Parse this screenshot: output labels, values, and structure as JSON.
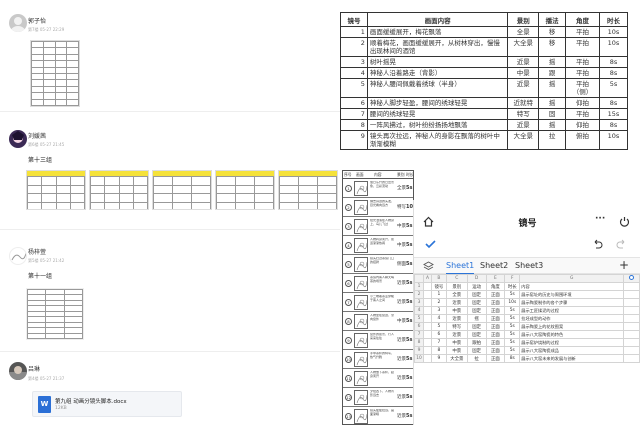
{
  "feed": {
    "posts": [
      {
        "name": "郭子怡",
        "meta": "第7楼  05-27 22:29"
      },
      {
        "name": "刘媛茜",
        "meta": "第6楼  05-27 21:45",
        "text": "第十三组"
      },
      {
        "name": "杨梓萱",
        "meta": "第5楼  05-27 21:42",
        "text": "第十一组"
      },
      {
        "name": "吕琳",
        "meta": "第4楼  05-27 21:37",
        "attachment": {
          "icon": "word-doc-icon",
          "name": "第九组 动画分镜头脚本.docx",
          "size": "12KB",
          "glyph": "W"
        }
      }
    ]
  },
  "shot_table": {
    "headers": [
      "镜号",
      "画面内容",
      "景别",
      "播法",
      "角度",
      "时长"
    ],
    "rows": [
      [
        "1",
        "画面缓缓展开，梅花飘落",
        "全景",
        "移",
        "平拍",
        "10s"
      ],
      [
        "2",
        "顺着梅花，画面缓缓展开，从树林穿出，慢慢出现林间的酒馆",
        "大全景",
        "移",
        "平拍",
        "10s"
      ],
      [
        "3",
        "树叶摇晃",
        "近景",
        "摇",
        "平拍",
        "8s"
      ],
      [
        "4",
        "神秘人沿着路走（背影）",
        "中景",
        "跟",
        "平拍",
        "8s"
      ],
      [
        "5",
        "神秘人腰间佩戴着绣球（半身）",
        "近景",
        "摇",
        "平拍（侧）",
        "5s"
      ],
      [
        "6",
        "神秘人脚步轻盈，腰间的绣球轻晃",
        "近就特",
        "摇",
        "仰拍",
        "8s"
      ],
      [
        "7",
        "腰间的绣球轻晃",
        "特写",
        "固",
        "平拍",
        "15s"
      ],
      [
        "8",
        "一阵风拂过，树叶纷纷扬扬地飘落",
        "近景",
        "摇",
        "仰拍",
        "8s"
      ],
      [
        "9",
        "镜头再次拉远，神秘人的身影在飘落的树叶中渐渐模糊",
        "大全景",
        "拉",
        "俯拍",
        "10s"
      ]
    ]
  },
  "storyboard": {
    "headers": [
      "序号",
      "画面",
      "内容",
      "景别",
      "时长"
    ],
    "rows": [
      {
        "num": "1",
        "desc": "旭日东升的日出景象，云彩流动",
        "kind": "全景",
        "dur": "5s"
      },
      {
        "num": "2",
        "desc": "拂去耳边的头发，目光看向远方",
        "kind": "特写",
        "dur": "10s"
      },
      {
        "num": "3",
        "desc": "阳光洒落在人物身上，鸟儿飞过",
        "kind": "中景",
        "dur": "5s"
      },
      {
        "num": "4",
        "desc": "人物转身离开，街道渐渐热闹",
        "kind": "中景",
        "dur": "5s"
      },
      {
        "num": "5",
        "desc": "镜头扫过茶馆门口的招牌",
        "kind": "侧面",
        "dur": "5s"
      },
      {
        "num": "6",
        "desc": "茶馆内客人聊天喝茶的场景",
        "kind": "近景",
        "dur": "5s"
      },
      {
        "num": "7",
        "desc": "小二端着茶壶穿梭于客人之间",
        "kind": "近景",
        "dur": "5s"
      },
      {
        "num": "8",
        "desc": "人物坐在窗边，望向窗外",
        "kind": "中景",
        "dur": "5s"
      },
      {
        "num": "9",
        "desc": "窗外的街景，行人来来往往",
        "kind": "近景",
        "dur": "5s"
      },
      {
        "num": "10",
        "desc": "手中茶杯的特写，热气升腾",
        "kind": "近景",
        "dur": "5s"
      },
      {
        "num": "11",
        "desc": "人物放下茶杯，起身离开",
        "kind": "近景",
        "dur": "5s"
      },
      {
        "num": "12",
        "desc": "夕阳西下，人物背影远去",
        "kind": "近景",
        "dur": "5s"
      },
      {
        "num": "13",
        "desc": "镜头缓缓拉远，画面渐暗",
        "kind": "近景",
        "dur": "5s"
      }
    ]
  },
  "sheet_app": {
    "title": "镜号",
    "icons": {
      "home": "home-icon",
      "more": "more-icon",
      "power": "power-icon",
      "check": "check-icon",
      "undo": "undo-icon",
      "redo": "redo-icon",
      "layers": "layers-icon",
      "add": "add-sheet-icon"
    },
    "tabs": [
      "Sheet1",
      "Sheet2",
      "Sheet3"
    ],
    "active_tab": 0,
    "col_letters": [
      "",
      "A",
      "B",
      "C",
      "D",
      "E",
      "F",
      "G"
    ],
    "header_row": [
      "1",
      "",
      "镜号",
      "景别",
      "运动",
      "角度",
      "时长",
      "内容"
    ],
    "rows": [
      [
        "2",
        "",
        "1",
        "全景",
        "固定",
        "正面",
        "5s",
        "展示窑址的历史与周围环境"
      ],
      [
        "3",
        "",
        "2",
        "近景",
        "固定",
        "正面",
        "10s",
        "展示陶瓷制作的各个步骤"
      ],
      [
        "4",
        "",
        "3",
        "中景",
        "固定",
        "正面",
        "5s",
        "展示工匠揉泥的过程"
      ],
      [
        "5",
        "",
        "4",
        "近景",
        "摇",
        "正面",
        "5s",
        "拉坯成型的动作"
      ],
      [
        "6",
        "",
        "5",
        "特写",
        "固定",
        "正面",
        "5s",
        "展示陶瓷上的花纹图案"
      ],
      [
        "7",
        "",
        "6",
        "近景",
        "固定",
        "正面",
        "5s",
        "展示八大窑陶瓷的特色"
      ],
      [
        "8",
        "",
        "7",
        "中景",
        "跟拍",
        "正面",
        "5s",
        "展示窑炉烧制的过程"
      ],
      [
        "9",
        "",
        "8",
        "中景",
        "固定",
        "正面",
        "5s",
        "展示八大窑陶瓷成品"
      ],
      [
        "10",
        "",
        "9",
        "大全景",
        "拉",
        "正面",
        "8s",
        "展示八大窑未来的发展与创新"
      ]
    ]
  }
}
